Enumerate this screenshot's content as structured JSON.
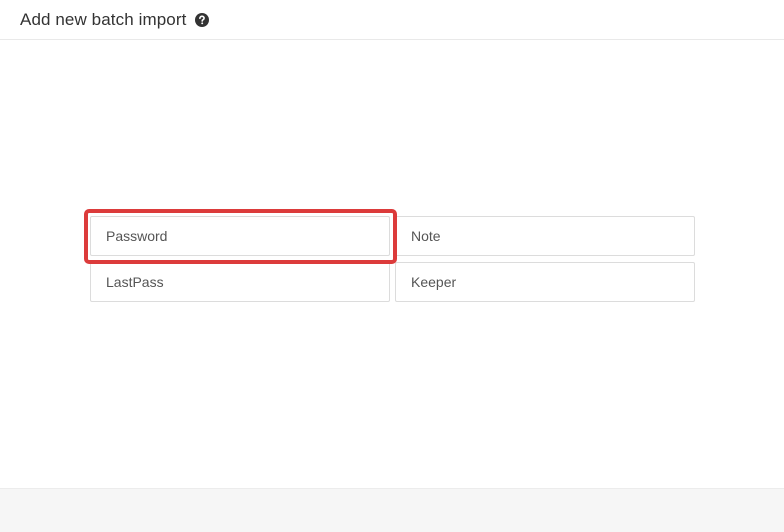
{
  "header": {
    "title": "Add new batch import",
    "help_icon": "question-circle-icon"
  },
  "options": {
    "password": "Password",
    "note": "Note",
    "lastpass": "LastPass",
    "keeper": "Keeper"
  },
  "highlight": {
    "target": "Password",
    "color": "#dc3b3b"
  }
}
